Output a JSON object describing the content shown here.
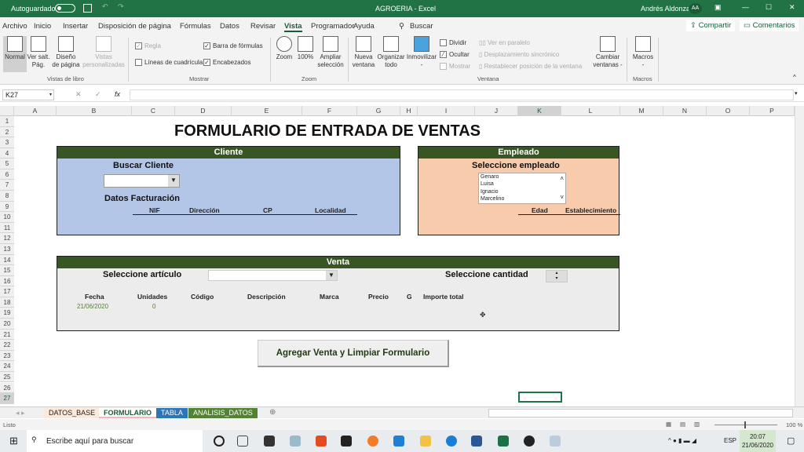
{
  "titlebar": {
    "autosave": "Autoguardado",
    "title": "AGROERIA  -  Excel",
    "user": "Andrés Aldonza",
    "initials": "AA"
  },
  "menu": [
    "Archivo",
    "Inicio",
    "Insertar",
    "Disposición de página",
    "Fórmulas",
    "Datos",
    "Revisar",
    "Vista",
    "Programador",
    "Ayuda"
  ],
  "search": "Buscar",
  "share": "Compartir",
  "comments": "Comentarios",
  "ribbon": {
    "normal": "Normal",
    "ver_salt": [
      "Ver salt.",
      "Pág."
    ],
    "diseno": [
      "Diseño",
      "de página"
    ],
    "vistas_pers": [
      "Vistas",
      "personalizadas"
    ],
    "g_vistas": "Vistas de libro",
    "regla": "Regla",
    "barra_formulas": "Barra de fórmulas",
    "lineas": "Líneas de cuadrícula",
    "encabezados": "Encabezados",
    "g_mostrar": "Mostrar",
    "zoom": "Zoom",
    "zoom100": "100%",
    "ampliar": [
      "Ampliar",
      "selección"
    ],
    "g_zoom": "Zoom",
    "nueva": [
      "Nueva",
      "ventana"
    ],
    "organizar": [
      "Organizar",
      "todo"
    ],
    "inmovilizar": [
      "Inmovilizar",
      "-"
    ],
    "dividir": "Dividir",
    "ocultar": "Ocultar",
    "mostrar": "Mostrar",
    "paralelo": "Ver en paralelo",
    "desplazamiento": "Desplazamiento sincrónico",
    "restablecer": "Restablecer posición de la ventana",
    "cambiar": [
      "Cambiar",
      "ventanas -"
    ],
    "g_ventana": "Ventana",
    "macros": [
      "Macros",
      "-"
    ],
    "g_macros": "Macros"
  },
  "formula_bar": {
    "namebox": "K27",
    "fx": "fx",
    "value": ""
  },
  "columns": [
    "A",
    "B",
    "C",
    "D",
    "E",
    "F",
    "G",
    "H",
    "I",
    "J",
    "K",
    "L",
    "M",
    "N",
    "O",
    "P"
  ],
  "form": {
    "title": "FORMULARIO DE ENTRADA DE VENTAS",
    "cliente": {
      "header": "Cliente",
      "buscar": "Buscar Cliente",
      "datos": "Datos Facturación",
      "cols": [
        "NIF",
        "Dirección",
        "CP",
        "Localidad"
      ]
    },
    "empleado": {
      "header": "Empleado",
      "seleccione": "Seleccione empleado",
      "list": [
        "Genaro",
        "Luisa",
        "Ignacio",
        "Marcelino"
      ],
      "cols": [
        "Edad",
        "Establecimiento"
      ]
    },
    "venta": {
      "header": "Venta",
      "articulo": "Seleccione artículo",
      "cantidad": "Seleccione cantidad",
      "cols": [
        "Fecha",
        "Unidades",
        "Código",
        "Descripción",
        "Marca",
        "Precio",
        "G",
        "Importe total"
      ],
      "fecha": "21/06/2020",
      "unidades": "0"
    },
    "button": "Agregar Venta y Limpiar Formulario"
  },
  "sheets": [
    {
      "name": "DATOS_BASE",
      "color": "#f8cbad"
    },
    {
      "name": "FORMULARIO",
      "color": "#f4b6b6"
    },
    {
      "name": "TABLA",
      "color": "#2e75b6"
    },
    {
      "name": "ANALISIS_DATOS",
      "color": "#548235"
    }
  ],
  "status": {
    "ready": "Listo",
    "zoom": "100 %"
  },
  "taskbar": {
    "search": "Escribe aquí para buscar",
    "lang": "ESP",
    "time": "20:07",
    "date": "21/06/2020"
  }
}
